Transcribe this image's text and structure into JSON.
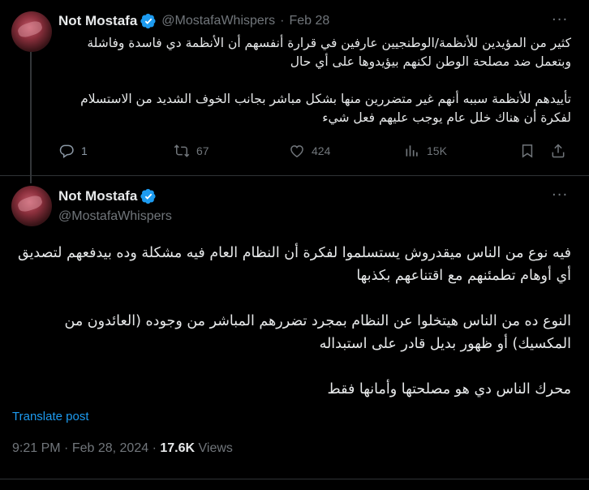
{
  "tweet1": {
    "display_name": "Not Mostafa",
    "handle": "@MostafaWhispers",
    "separator": "·",
    "date": "Feb 28",
    "more": "···",
    "body": "كثير من المؤيدين للأنظمة/الوطنجيين عارفين في قرارة أنفسهم أن الأنظمة دي فاسدة وفاشلة وبتعمل ضد مصلحة الوطن لكنهم بيؤيدوها على أي حال\n\nتأييدهم للأنظمة سببه أنهم غير متضررين منها بشكل مباشر بجانب الخوف الشديد من الاستسلام لفكرة أن هناك خلل عام يوجب عليهم فعل شيء",
    "replies": "1",
    "reposts": "67",
    "likes": "424",
    "views": "15K"
  },
  "tweet2": {
    "display_name": "Not Mostafa",
    "handle": "@MostafaWhispers",
    "more": "···",
    "body": "فيه نوع من الناس ميقدروش يستسلموا لفكرة أن النظام العام فيه مشكلة وده بيدفعهم لتصديق أي أوهام تطمئنهم مع اقتناعهم بكذبها\n\nالنوع ده من الناس هيتخلوا عن النظام بمجرد تضررهم المباشر من وجوده (العائدون من المكسيك) أو ظهور بديل قادر على استبداله\n\nمحرك الناس دي هو مصلحتها وأمانها فقط",
    "translate": "Translate post",
    "time": "9:21 PM",
    "dot": "·",
    "date": "Feb 28, 2024",
    "views_count": "17.6K",
    "views_label": "Views"
  },
  "colors": {
    "accent": "#1d9bf0",
    "muted": "#71767b",
    "text": "#e7e9ea",
    "background": "#000000",
    "border": "#2f3336"
  },
  "icons": [
    "verified-badge-icon",
    "more-icon",
    "reply-icon",
    "repost-icon",
    "like-icon",
    "views-icon",
    "bookmark-icon",
    "share-icon"
  ]
}
